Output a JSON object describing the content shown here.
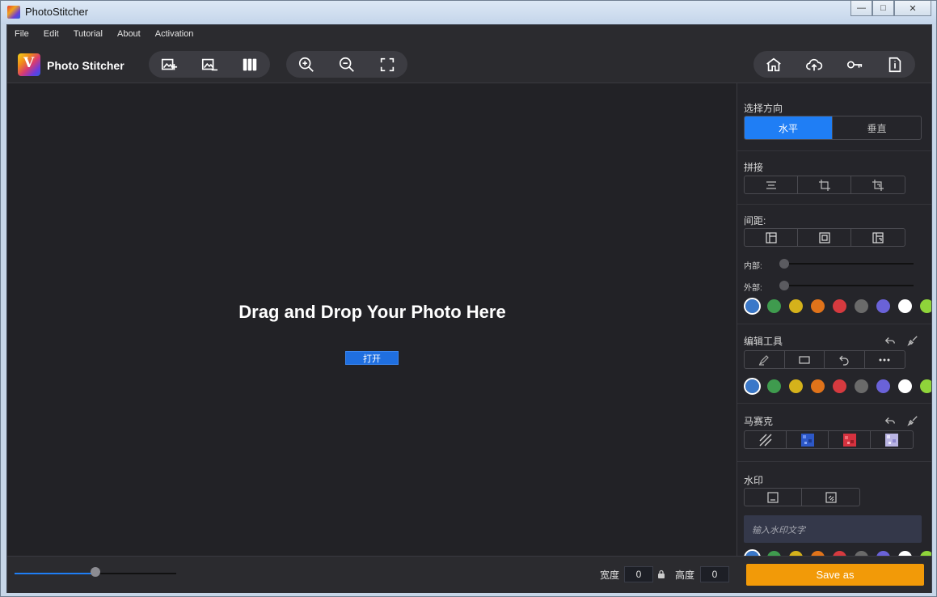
{
  "window": {
    "title": "PhotoStitcher"
  },
  "menu": [
    {
      "label": "File"
    },
    {
      "label": "Edit"
    },
    {
      "label": "Tutorial"
    },
    {
      "label": "About"
    },
    {
      "label": "Activation"
    }
  ],
  "toolbar": {
    "app_name": "Photo Stitcher"
  },
  "canvas": {
    "drop_text": "Drag and Drop Your Photo Here",
    "open_label": "打开"
  },
  "panel": {
    "direction": {
      "title": "选择方向",
      "options": [
        "水平",
        "垂直"
      ],
      "selected": "水平"
    },
    "stitch": {
      "title": "拼接"
    },
    "spacing": {
      "title": "间距:",
      "inner_label": "内部:",
      "outer_label": "外部:",
      "inner_value": 0,
      "outer_value": 0
    },
    "edit_tools": {
      "title": "编辑工具"
    },
    "mosaic": {
      "title": "马赛克"
    },
    "watermark": {
      "title": "水印",
      "placeholder": "输入水印文字"
    }
  },
  "swatch_colors": [
    "#3a78c9",
    "#3f9b4e",
    "#d5b21b",
    "#e0731a",
    "#d63a3f",
    "#6a6a6a",
    "#6a62d8",
    "#ffffff",
    "#8fd43a"
  ],
  "bottom": {
    "width_label": "宽度",
    "width_value": "0",
    "height_label": "高度",
    "height_value": "0",
    "save_label": "Save as",
    "zoom_fraction": 0.5
  }
}
